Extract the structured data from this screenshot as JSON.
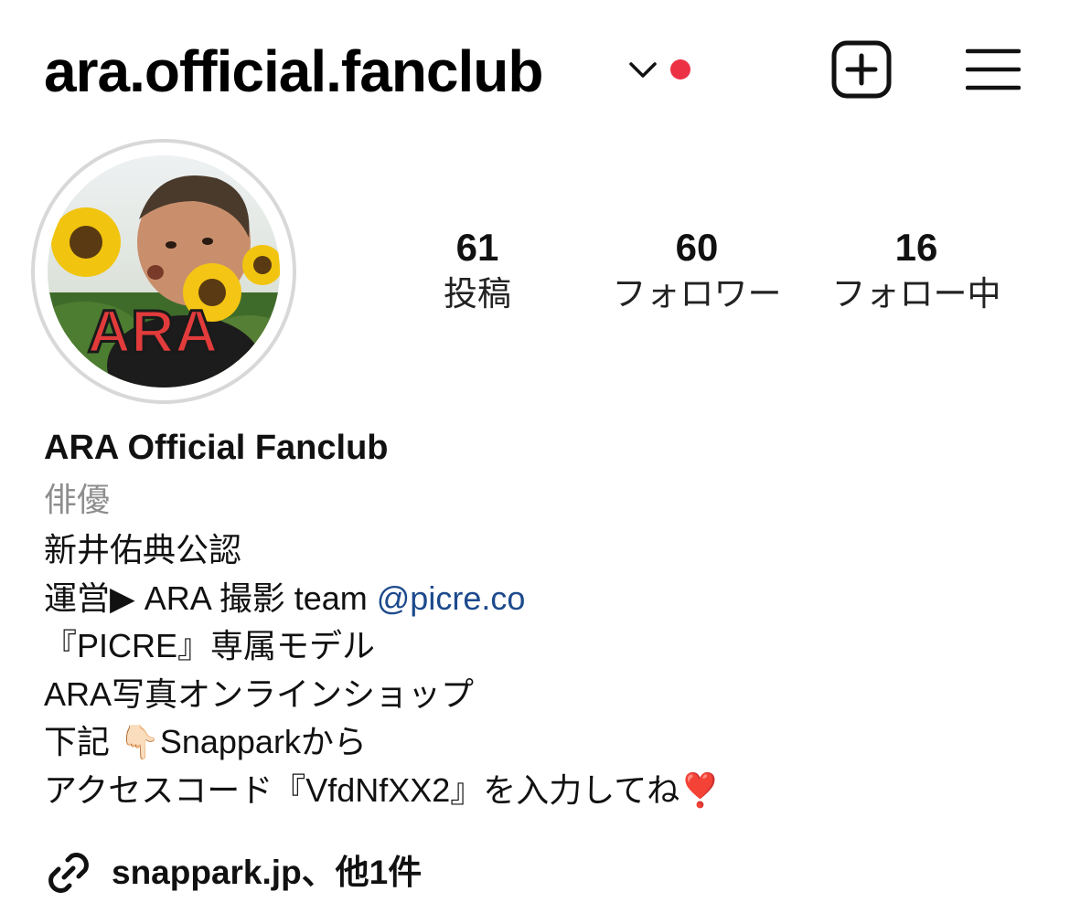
{
  "header": {
    "username": "ara.official.fanclub",
    "new_post_icon": "plus-square-icon",
    "menu_icon": "hamburger-menu-icon",
    "notification_dot_color": "#ed3145"
  },
  "avatar": {
    "badge_text": "ARA"
  },
  "stats": [
    {
      "count": "61",
      "label": "投稿"
    },
    {
      "count": "60",
      "label": "フォロワー"
    },
    {
      "count": "16",
      "label": "フォロー中"
    }
  ],
  "profile": {
    "display_name": "ARA Official Fanclub",
    "category": "俳優",
    "bio": {
      "line1": "新井佑典公認",
      "line2_prefix": "運営▶ ARA 撮影 team ",
      "line2_mention": "@picre.co",
      "line3": "『PICRE』専属モデル",
      "line4": "ARA写真オンラインショップ",
      "line5": "下記 👇🏻Snapparkから",
      "line6": "アクセスコード『VfdNfXX2』を入力してね❣️"
    },
    "link_text": "snappark.jp、他1件",
    "link_icon": "link-chain-icon",
    "mention_color": "#1c4a8c"
  }
}
